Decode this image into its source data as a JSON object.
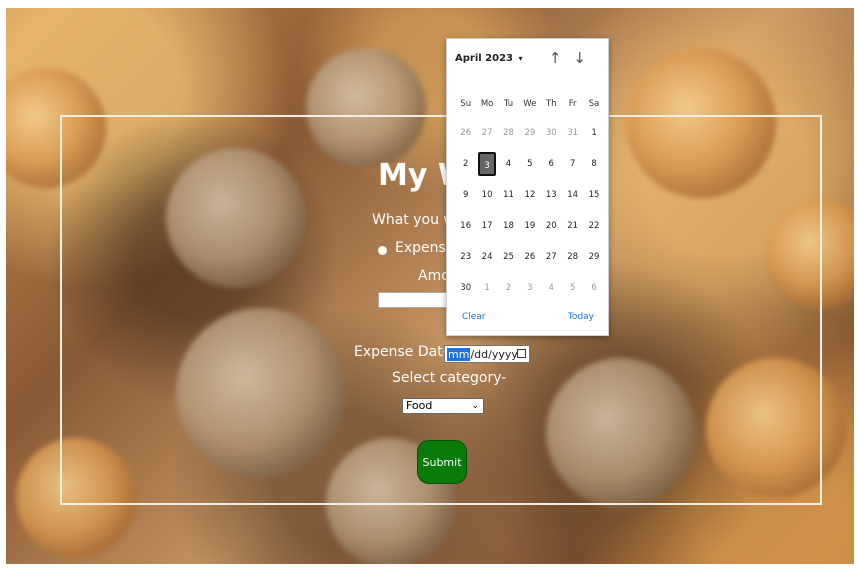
{
  "form": {
    "title": "My W",
    "prompt": "What you w",
    "radio_label": "Expense",
    "amount_label": "Amo",
    "amount_value": "",
    "date_label": "Expense Date:",
    "date_mm": "mm",
    "date_rest": "/dd/yyyy",
    "category_label": "Select category-",
    "category_selected": "Food",
    "submit_label": "Submit"
  },
  "calendar": {
    "month_label": "April 2023",
    "month_dropdown": "▾",
    "prev_icon": "arrow-up-icon",
    "next_icon": "arrow-down-icon",
    "weekdays": [
      "Su",
      "Mo",
      "Tu",
      "We",
      "Th",
      "Fr",
      "Sa"
    ],
    "weeks": [
      [
        "26",
        "27",
        "28",
        "29",
        "30",
        "31",
        "1"
      ],
      [
        "2",
        "3",
        "4",
        "5",
        "6",
        "7",
        "8"
      ],
      [
        "9",
        "10",
        "11",
        "12",
        "13",
        "14",
        "15"
      ],
      [
        "16",
        "17",
        "18",
        "19",
        "20",
        "21",
        "22"
      ],
      [
        "23",
        "24",
        "25",
        "26",
        "27",
        "28",
        "29"
      ],
      [
        "30",
        "1",
        "2",
        "3",
        "4",
        "5",
        "6"
      ]
    ],
    "selected": "3",
    "clear_label": "Clear",
    "today_label": "Today"
  },
  "colors": {
    "submit_bg": "#0a7a0a",
    "link": "#1a73e8",
    "selected_day_bg": "#666666"
  }
}
